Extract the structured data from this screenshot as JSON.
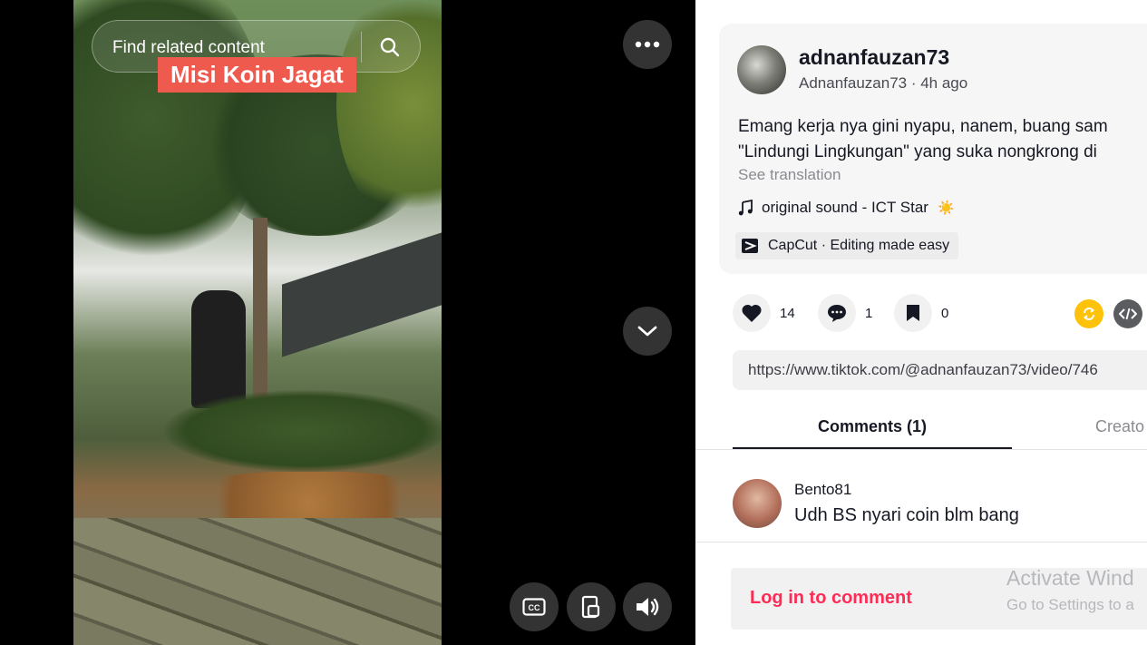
{
  "video": {
    "search_placeholder": "Find related content",
    "sticker_text": "Misi Koin Jagat",
    "icons": [
      "search-icon",
      "more-icon",
      "chevron-down-icon",
      "captions-icon",
      "picture-in-picture-icon",
      "volume-icon"
    ]
  },
  "post": {
    "author_name": "adnanfauzan73",
    "author_meta": "Adnanfauzan73 · 4h ago",
    "caption_line1": "Emang kerja nya gini nyapu, nanem, buang sam",
    "caption_line2": "\"Lindungi Lingkungan\" yang suka nongkrong di",
    "see_translation": "See translation",
    "sound": "original sound - ICT Star",
    "sound_emoji": "☀️",
    "capcut": "CapCut · Editing made easy"
  },
  "actions": {
    "likes": "14",
    "comments": "1",
    "saves": "0"
  },
  "link": "https://www.tiktok.com/@adnanfauzan73/video/746",
  "tabs": {
    "comments": "Comments (1)",
    "creator": "Creato"
  },
  "comment": {
    "user": "Bento81",
    "text": "Udh BS nyari coin blm bang"
  },
  "login_prompt": "Log in to comment",
  "watermark": {
    "title": "Activate Wind",
    "subtitle": "Go to Settings to a"
  },
  "colors": {
    "accent": "#fe2c55",
    "sticker": "#ee5a4e",
    "repost": "#fec20a"
  }
}
